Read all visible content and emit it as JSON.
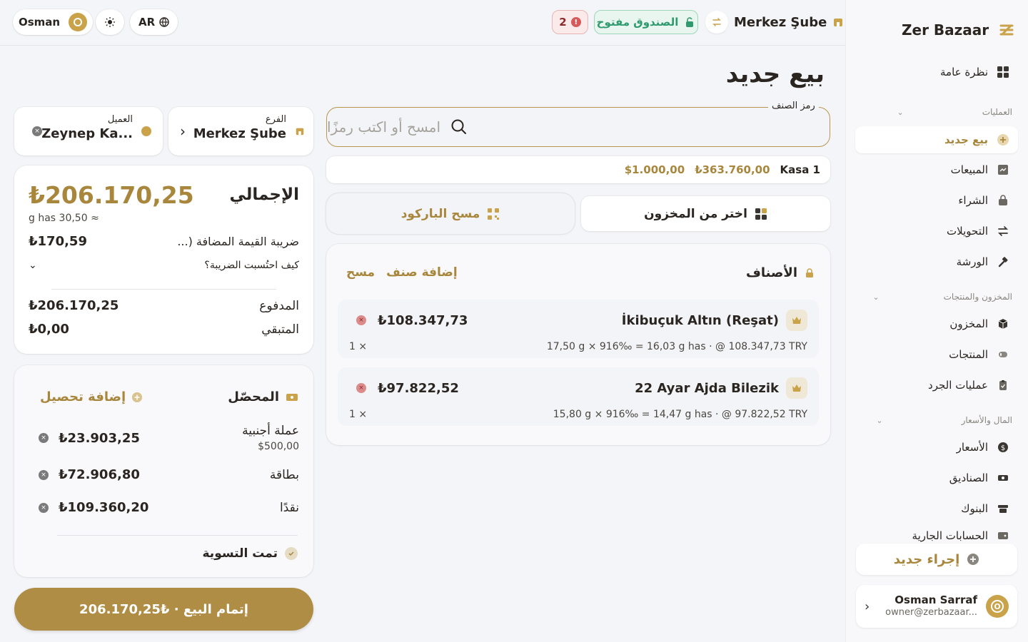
{
  "topbar": {
    "user_name": "Osman",
    "user_initial": "O",
    "lang": "AR",
    "badge_count": "2",
    "register_status": "الصندوق مفتوح",
    "branch": "Merkez Şube"
  },
  "sidebar": {
    "brand": "Zer Bazaar",
    "overview": "نظرة عامة",
    "sections": {
      "operations": "العمليات",
      "inventory": "المخزون والمنتجات",
      "money": "المال والأسعار"
    },
    "items": {
      "new_sale": "بيع جديد",
      "sales": "المبيعات",
      "purchase": "الشراء",
      "transfers": "التحويلات",
      "workshop": "الورشة",
      "stock": "المخزون",
      "products": "المنتجات",
      "stocktake": "عمليات الجرد",
      "rates": "الأسعار",
      "registers": "الصناديق",
      "banks": "البنوك",
      "current_accounts": "الحسابات الجارية"
    },
    "new_action": "إجراء جديد",
    "account": {
      "name": "Osman Sarraf",
      "email": "owner@zerbazaar...",
      "initial": "O"
    }
  },
  "page": {
    "title": "بيع جديد"
  },
  "search": {
    "label": "رمز الصنف",
    "placeholder": "امسح أو اكتب رمزًا"
  },
  "register_bar": {
    "name": "Kasa 1",
    "try_balance": "₺363.760,00",
    "usd_balance": "$1.000,00"
  },
  "actions": {
    "pick_from_stock": "اختر من المخزون",
    "scan_barcode": "مسح الباركود"
  },
  "items_card": {
    "title": "الأصناف",
    "add_item": "إضافة صنف",
    "clear": "مسح",
    "lines": [
      {
        "name": "İkibuçuk Altın (Reşat)",
        "amount": "₺108.347,73",
        "detail": "17,50 g × 916‰ = 16,03 g has · @ 108.347,73 TRY",
        "qty": "1 ×"
      },
      {
        "name": "22 Ayar Ajda Bilezik",
        "amount": "₺97.822,52",
        "detail": "15,80 g × 916‰ = 14,47 g has · @ 97.822,52 TRY",
        "qty": "1 ×"
      }
    ]
  },
  "context": {
    "branch_label": "الفرع",
    "branch_value": "Merkez Şube",
    "customer_label": "العميل",
    "customer_value": "Zeynep Ka..."
  },
  "totals": {
    "title": "الإجمالي",
    "amount": "₺206.170,25",
    "has": "≈ 30,50 g has",
    "vat_label": "ضريبة القيمة المضافة (...",
    "vat_amount": "₺170,59",
    "vat_howto": "كيف احتُسبت الضريبة؟",
    "paid_label": "المدفوع",
    "paid_amount": "₺206.170,25",
    "remaining_label": "المتبقي",
    "remaining_amount": "₺0,00"
  },
  "collected": {
    "title": "المحصّل",
    "add": "إضافة تحصيل",
    "lines": [
      {
        "label": "عملة أجنبية",
        "sub": "$500,00",
        "amount": "₺23.903,25"
      },
      {
        "label": "بطاقة",
        "sub": "",
        "amount": "₺72.906,80"
      },
      {
        "label": "نقدًا",
        "sub": "",
        "amount": "₺109.360,20"
      }
    ],
    "settled": "تمت التسوية"
  },
  "complete_button": "إتمام البيع · ₺206.170,25",
  "colors": {
    "accent": "#a8863c",
    "primary_button": "#b08d45",
    "register_open": "#2f9a6d"
  }
}
